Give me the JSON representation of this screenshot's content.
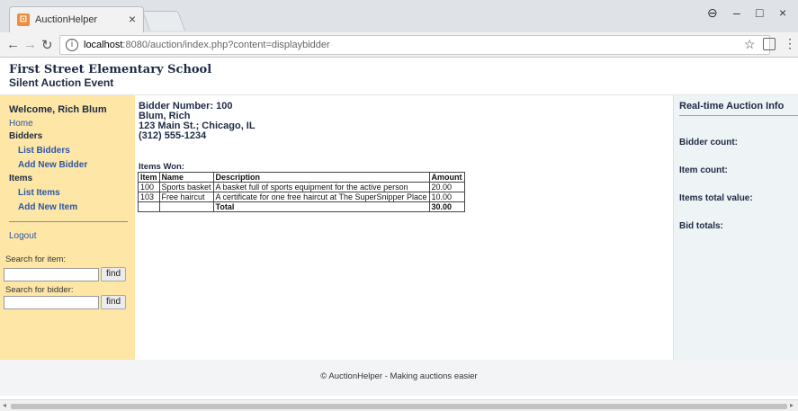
{
  "browser": {
    "tab_title": "AuctionHelper",
    "tab_close": "×",
    "favicon": "auction-favicon",
    "url_host": "localhost",
    "url_rest": ":8080/auction/index.php?content=displaybidder",
    "window_controls": {
      "account": "⊖",
      "minimize": "–",
      "maximize": "□",
      "close": "×"
    }
  },
  "site": {
    "title": "First Street Elementary School",
    "subtitle": "Silent Auction Event"
  },
  "sidebar": {
    "welcome": "Welcome, Rich Blum",
    "home": "Home",
    "bidders_heading": "Bidders",
    "list_bidders": "List Bidders",
    "add_bidder": "Add New Bidder",
    "items_heading": "Items",
    "list_items": "List Items",
    "add_item": "Add New Item",
    "logout": "Logout",
    "search_item_label": "Search for item:",
    "search_bidder_label": "Search for bidder:",
    "find_label": "find"
  },
  "bidder": {
    "number_line": "Bidder Number: 100",
    "name": "Blum, Rich",
    "address": "123 Main St.; Chicago, IL",
    "phone": "(312) 555-1234",
    "items_won_label": "Items Won:",
    "table": {
      "headers": [
        "Item",
        "Name",
        "Description",
        "Amount"
      ],
      "rows": [
        [
          "100",
          "Sports basket",
          "A basket full of sports equipment for the active person",
          "20.00"
        ],
        [
          "103",
          "Free haircut",
          "A certificate for one free haircut at The SuperSnipper Place",
          "10.00"
        ]
      ],
      "total_label": "Total",
      "total_amount": "30.00"
    }
  },
  "rightbar": {
    "title": "Real-time Auction Info",
    "bidder_count": "Bidder count:",
    "item_count": "Item count:",
    "items_total_value": "Items total value:",
    "bid_totals": "Bid totals:"
  },
  "footer": {
    "text": "© AuctionHelper - Making auctions easier"
  }
}
